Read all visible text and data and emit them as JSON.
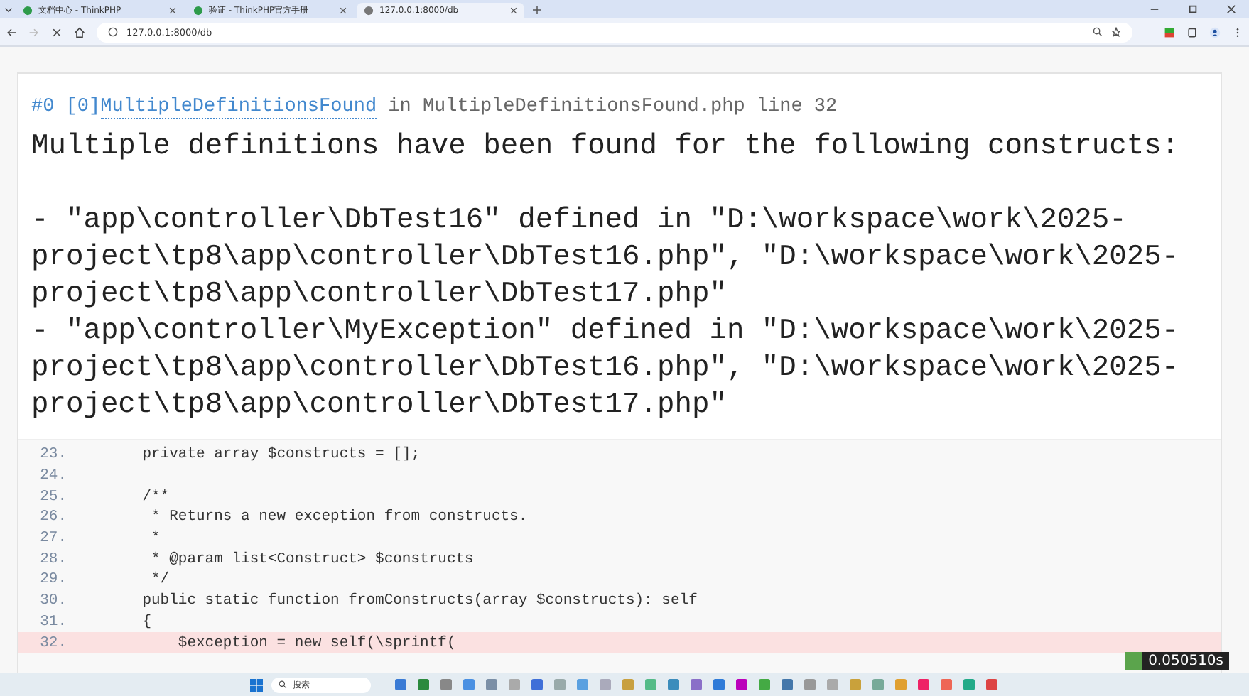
{
  "browser": {
    "tabs": [
      {
        "title": "文档中心 - ThinkPHP",
        "selected": false
      },
      {
        "title": "验证 - ThinkPHP官方手册",
        "selected": false
      },
      {
        "title": "127.0.0.1:8000/db",
        "selected": true
      }
    ],
    "address": "127.0.0.1:8000/db"
  },
  "exception": {
    "trace_index": "#0 [0]",
    "class": "MultipleDefinitionsFound",
    "location": "in MultipleDefinitionsFound.php line 32",
    "message": "Multiple definitions have been found for the following constructs:",
    "details": [
      "- \"app\\controller\\DbTest16\" defined in \"D:\\workspace\\work\\2025-project\\tp8\\app\\controller\\DbTest16.php\", \"D:\\workspace\\work\\2025-project\\tp8\\app\\controller\\DbTest17.php\"",
      "- \"app\\controller\\MyException\" defined in \"D:\\workspace\\work\\2025-project\\tp8\\app\\controller\\DbTest16.php\", \"D:\\workspace\\work\\2025-project\\tp8\\app\\controller\\DbTest17.php\""
    ]
  },
  "source": [
    {
      "number": "23.",
      "code": "    private array $constructs = [];",
      "selected": false
    },
    {
      "number": "24.",
      "selected": false
    },
    {
      "number": "25.",
      "code": "    /**",
      "selected": false
    },
    {
      "number": "26.",
      "code": "     * Returns a new exception from constructs.",
      "selected": false
    },
    {
      "number": "27.",
      "code": "     *",
      "selected": false
    },
    {
      "number": "28.",
      "code": "     * @param list<Construct> $constructs",
      "selected": false
    },
    {
      "number": "29.",
      "code": "     */",
      "selected": false
    },
    {
      "number": "30.",
      "code": "    public static function fromConstructs(array $constructs): self",
      "selected": false
    },
    {
      "number": "31.",
      "code": "    {",
      "selected": false
    },
    {
      "number": "32.",
      "code": "        $exception = new self(\\sprintf(",
      "selected": true
    }
  ],
  "trace_badge": "0.050510s",
  "taskbar": {
    "search": "搜索"
  }
}
